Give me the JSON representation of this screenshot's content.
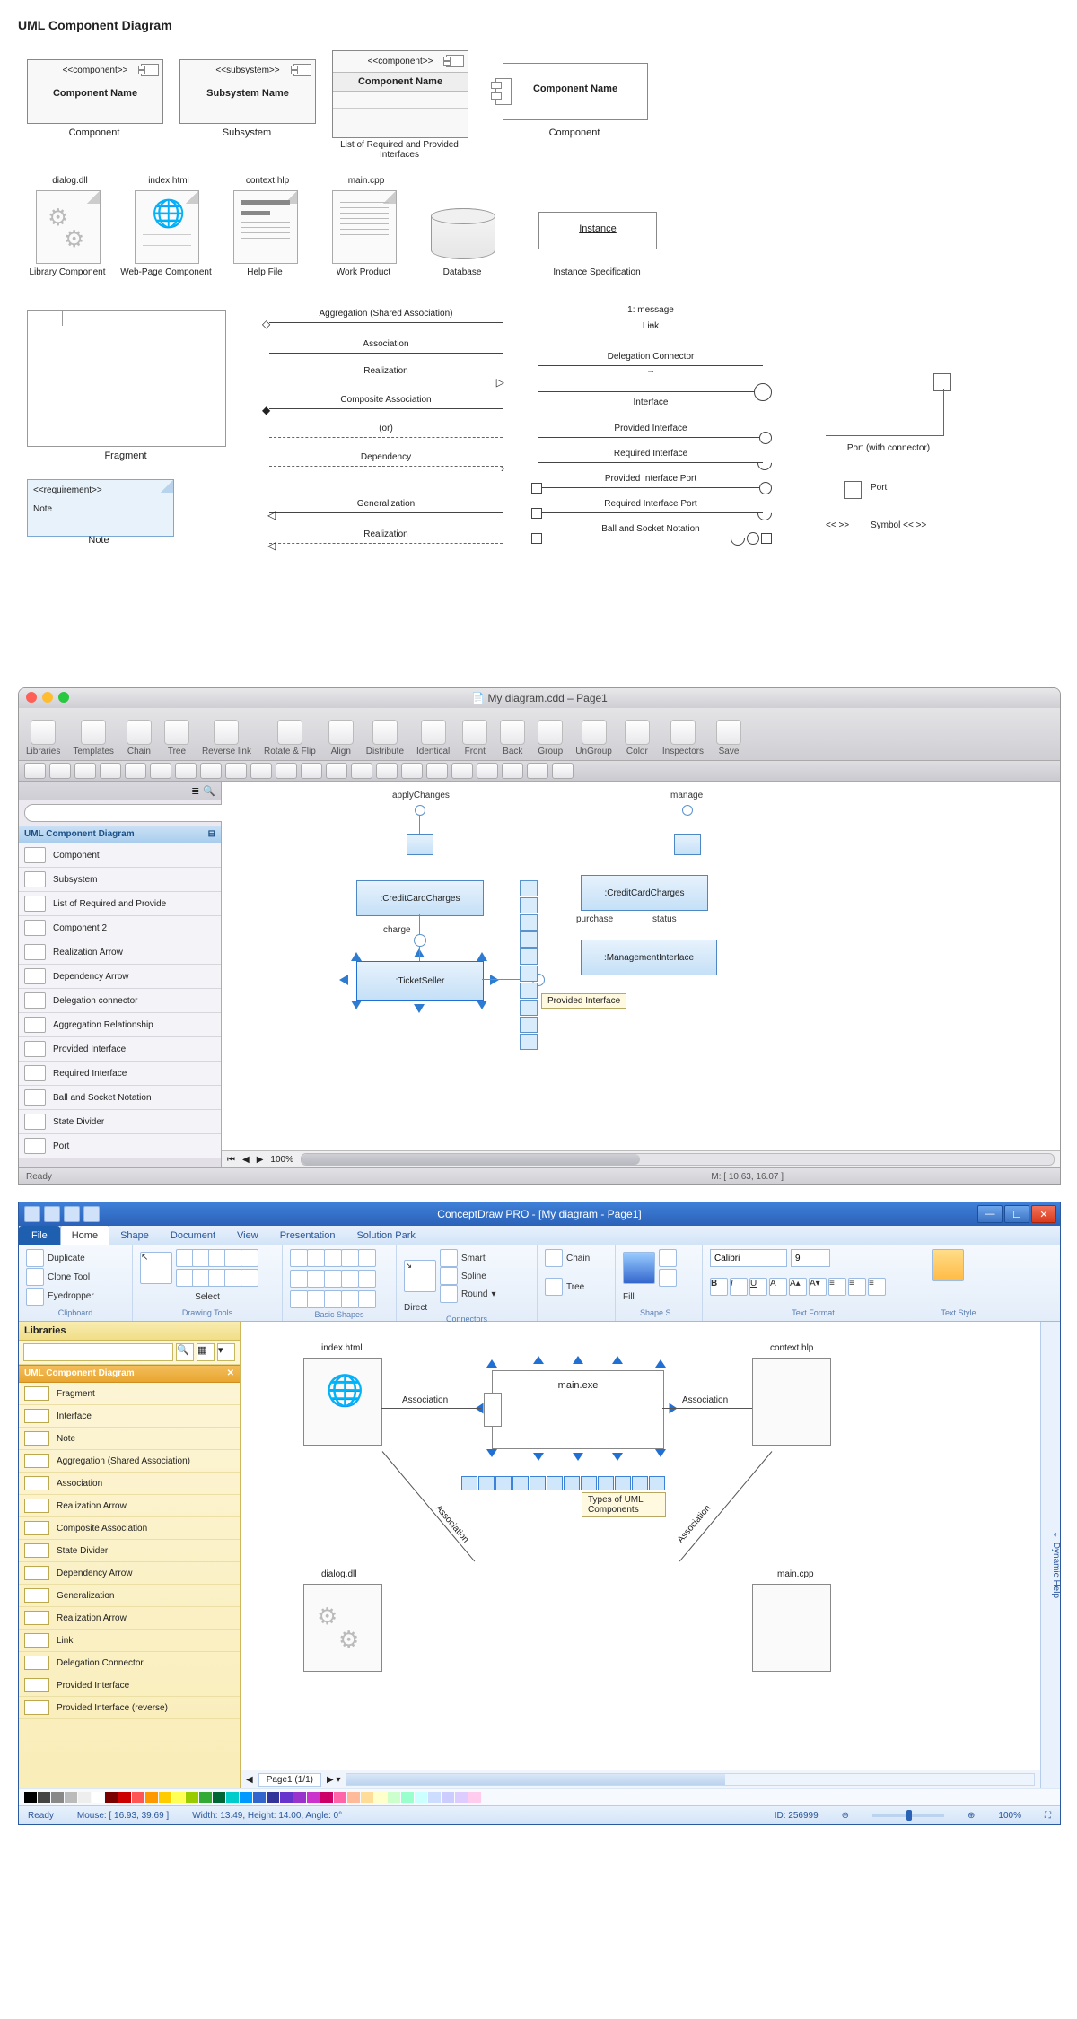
{
  "title": "UML Component Diagram",
  "palette": {
    "component": {
      "stereo": "<<component>>",
      "name": "Component Name",
      "label": "Component"
    },
    "subsystem": {
      "stereo": "<<subsystem>>",
      "name": "Subsystem Name",
      "label": "Subsystem"
    },
    "list_comp": {
      "stereo": "<<component>>",
      "name": "Component Name",
      "label": "List of Required and Provided Interfaces"
    },
    "component2": {
      "name": "Component Name",
      "label": "Component"
    },
    "files": {
      "lib": {
        "fname": "dialog.dll",
        "label": "Library Component"
      },
      "web": {
        "fname": "index.html",
        "label": "Web-Page Component"
      },
      "help": {
        "fname": "context.hlp",
        "label": "Help File"
      },
      "work": {
        "fname": "main.cpp",
        "label": "Work Product"
      },
      "db": {
        "label": "Database"
      },
      "inst": {
        "name": "Instance",
        "label": "Instance Specification"
      }
    },
    "fragment_label": "Fragment",
    "note": {
      "stereo": "<<requirement>>",
      "text": "Note",
      "label": "Note"
    },
    "connectors_left": [
      "Aggregation (Shared Association)",
      "Association",
      "Realization",
      "Composite Association",
      "(or)",
      "Dependency",
      "Generalization",
      "Realization"
    ],
    "connectors_right": [
      {
        "t": "1: message",
        "sub": "Link"
      },
      {
        "t": "Delegation Connector"
      },
      {
        "t": "Interface"
      },
      {
        "t": "Provided Interface"
      },
      {
        "t": "Required Interface"
      },
      {
        "t": "Provided Interface Port"
      },
      {
        "t": "Required Interface Port"
      },
      {
        "t": "Ball and Socket Notation"
      }
    ],
    "port_conn_label": "Port (with connector)",
    "port_label": "Port",
    "symbol_label": "Symbol << >>",
    "symbol_glyph": "<<  >>"
  },
  "mac": {
    "title": "My diagram.cdd – Page1",
    "toolbar": [
      "Libraries",
      "Templates",
      "Chain",
      "Tree",
      "Reverse link",
      "Rotate & Flip",
      "Align",
      "Distribute",
      "Identical",
      "Front",
      "Back",
      "Group",
      "UnGroup",
      "Color",
      "Inspectors",
      "Save"
    ],
    "side_header": "UML Component Diagram",
    "side_items": [
      "Component",
      "Subsystem",
      "List of Required and Provide",
      "Component 2",
      "Realization Arrow",
      "Dependency Arrow",
      "Delegation connector",
      "Aggregation Relationship",
      "Provided Interface",
      "Required Interface",
      "Ball and Socket Notation",
      "State Divider",
      "Port"
    ],
    "canvas": {
      "applyChanges": "applyChanges",
      "manage": "manage",
      "ccc1": ":CreditCardCharges",
      "ccc2": ":CreditCardCharges",
      "ticket": ":TicketSeller",
      "mgmt": ":ManagementInterface",
      "charge": "charge",
      "purchase": "purchase",
      "status": "status",
      "tooltip": "Provided Interface"
    },
    "search_ph": "",
    "zoom": "100%",
    "status_ready": "Ready",
    "status_mouse": "M: [ 10.63, 16.07 ]"
  },
  "win": {
    "title": "ConceptDraw PRO - [My diagram - Page1]",
    "tabs": [
      "Home",
      "Shape",
      "Document",
      "View",
      "Presentation",
      "Solution Park"
    ],
    "file": "File",
    "clipboard": {
      "dup": "Duplicate",
      "clone": "Clone Tool",
      "eye": "Eyedropper",
      "cap": "Clipboard"
    },
    "select": "Select",
    "drawing_cap": "Drawing Tools",
    "shapes_cap": "Basic Shapes",
    "connectors": {
      "direct": "Direct",
      "smart": "Smart",
      "spline": "Spline",
      "round": "Round",
      "cap": "Connectors"
    },
    "chain": "Chain",
    "tree": "Tree",
    "fill": "Fill",
    "shape_cap": "Shape S...",
    "font_name": "Calibri",
    "font_size": "9",
    "text_cap": "Text Format",
    "text_style": "Text Style",
    "libraries": "Libraries",
    "side_header": "UML Component Diagram",
    "side_items": [
      "Fragment",
      "Interface",
      "Note",
      "Aggregation (Shared Association)",
      "Association",
      "Realization Arrow",
      "Composite Association",
      "State Divider",
      "Dependency Arrow",
      "Generalization",
      "Realization Arrow",
      "Link",
      "Delegation Connector",
      "Provided Interface",
      "Provided Interface (reverse)"
    ],
    "dyn_help": "Dynamic Help",
    "canvas": {
      "index": "index.html",
      "context": "context.hlp",
      "exe": "main.exe",
      "dll": "dialog.dll",
      "cpp": "main.cpp",
      "assoc": "Association",
      "tooltip": "Types of UML Components"
    },
    "page_tab": "Page1 (1/1)",
    "status": {
      "ready": "Ready",
      "mouse": "Mouse: [ 16.93, 39.69 ]",
      "size": "Width: 13.49,  Height: 14.00,  Angle: 0°",
      "id": "ID: 256999",
      "zoom": "100%"
    },
    "swatches": [
      "#000",
      "#444",
      "#888",
      "#bbb",
      "#eee",
      "#fff",
      "#7a0000",
      "#c00",
      "#f55",
      "#f90",
      "#fc0",
      "#ff5",
      "#9c0",
      "#3a3",
      "#063",
      "#0cc",
      "#09f",
      "#36c",
      "#339",
      "#63c",
      "#93c",
      "#c3c",
      "#c06",
      "#f6a",
      "#fb9",
      "#fd9",
      "#ffc",
      "#cfc",
      "#9fc",
      "#cff",
      "#cdf",
      "#ccf",
      "#dcf",
      "#fce"
    ]
  }
}
